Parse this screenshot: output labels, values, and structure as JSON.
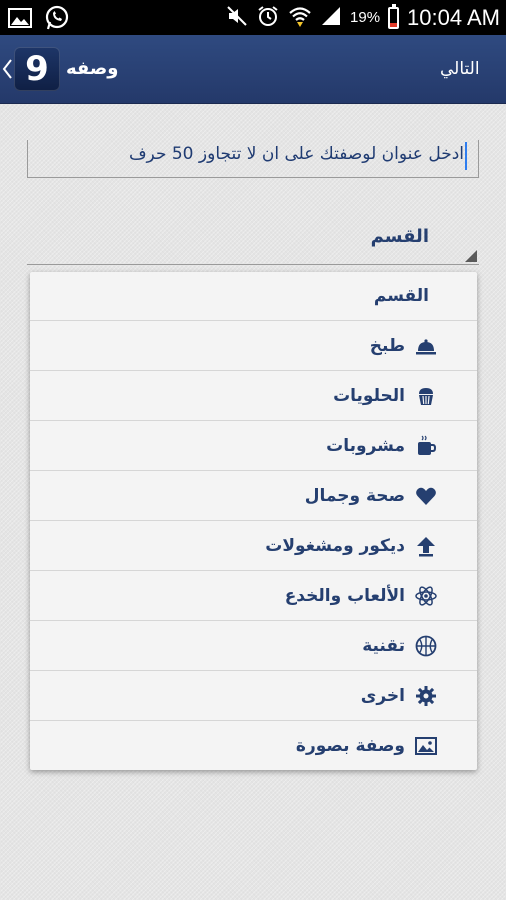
{
  "status_bar": {
    "battery_text": "19%",
    "battery_level": 0.19,
    "time": "10:04 AM",
    "left_icons": [
      "image-icon",
      "whatsapp-icon"
    ],
    "right_icons": [
      "mute-icon",
      "alarm-icon",
      "wifi-icon",
      "signal-icon",
      "battery-icon"
    ]
  },
  "action_bar": {
    "next_label": "التالي",
    "title": "وصفه",
    "logo_text": "9"
  },
  "form": {
    "title_field": {
      "value": "ادخل عنوان لوصفتك على ان لا تتجاوز 50 حرف"
    },
    "category_spinner": {
      "selected": "القسم"
    }
  },
  "dropdown": {
    "header": "القسم",
    "items": [
      {
        "label": "طبخ",
        "icon": "cloche-icon"
      },
      {
        "label": "الحلويات",
        "icon": "cupcake-icon"
      },
      {
        "label": "مشروبات",
        "icon": "coffee-cup-icon"
      },
      {
        "label": "صحة وجمال",
        "icon": "heart-icon"
      },
      {
        "label": "ديكور ومشغولات",
        "icon": "upload-arrow-icon"
      },
      {
        "label": "الألعاب والخدع",
        "icon": "atom-icon"
      },
      {
        "label": "تقنية",
        "icon": "basketball-icon"
      },
      {
        "label": "اخرى",
        "icon": "gear-icon"
      },
      {
        "label": "وصفة بصورة",
        "icon": "picture-icon"
      }
    ]
  },
  "colors": {
    "action_bar": "#2a4275",
    "accent_text": "#253f70",
    "cursor": "#2e7df0"
  }
}
